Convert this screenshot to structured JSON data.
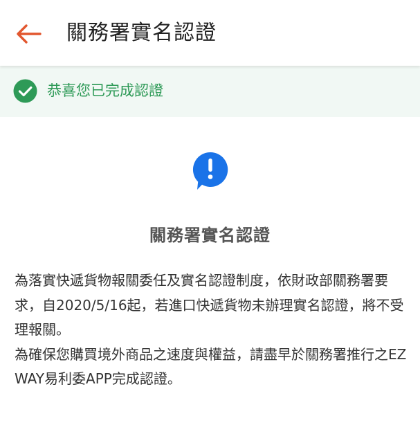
{
  "header": {
    "back_icon": "arrow-left-icon",
    "title": "關務署實名認證",
    "accent_color": "#e2572f"
  },
  "banner": {
    "icon": "check-circle-icon",
    "text": "恭喜您已完成認證",
    "color": "#2e9a57",
    "background": "#f1f8f4"
  },
  "content": {
    "icon": "info-speech-bubble-icon",
    "icon_color": "#1a73e8",
    "title": "關務署實名認證",
    "paragraphs": [
      "為落實快遞貨物報關委任及實名認證制度，依財政部關務署要求，自2020/5/16起，若進口快遞貨物未辦理實名認證，將不受理報關。",
      "為確保您購買境外商品之速度與權益，請盡早於關務署推行之EZ WAY易利委APP完成認證。"
    ]
  }
}
